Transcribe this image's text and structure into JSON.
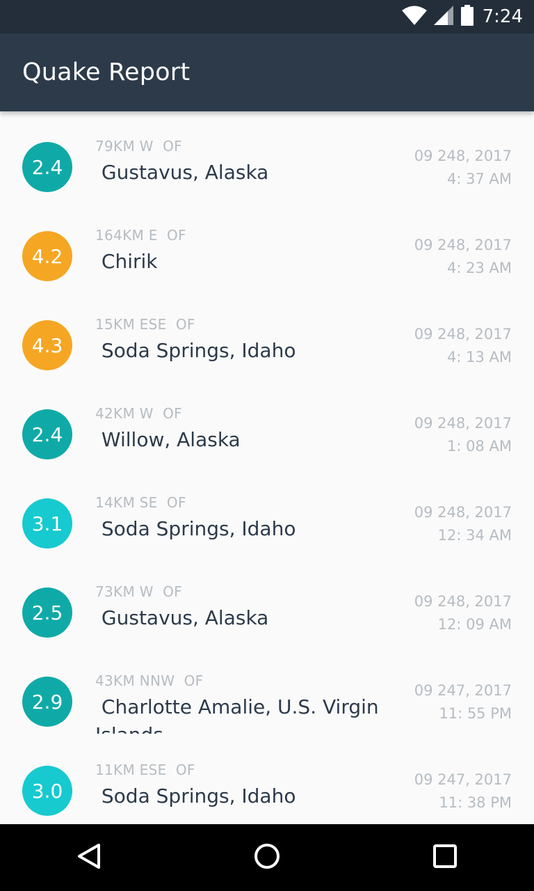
{
  "status_bar": {
    "time": "7:24",
    "icons": [
      "wifi-icon",
      "cell-signal-icon",
      "battery-icon"
    ]
  },
  "app_bar": {
    "title": "Quake Report",
    "color": "#2c3a4a"
  },
  "earthquakes": [
    {
      "magnitude": "2.4",
      "offset": "79KM W  OF",
      "place": " Gustavus, Alaska",
      "date": "09 248, 2017",
      "time": "4: 37 AM",
      "color": "#0faaa7"
    },
    {
      "magnitude": "4.2",
      "offset": "164KM E  OF",
      "place": " Chirik",
      "date": "09 248, 2017",
      "time": "4: 23 AM",
      "color": "#f5a623"
    },
    {
      "magnitude": "4.3",
      "offset": "15KM ESE  OF",
      "place": " Soda Springs, Idaho",
      "date": "09 248, 2017",
      "time": "4: 13 AM",
      "color": "#f5a623"
    },
    {
      "magnitude": "2.4",
      "offset": "42KM W  OF",
      "place": " Willow, Alaska",
      "date": "09 248, 2017",
      "time": "1: 08 AM",
      "color": "#0faaa7"
    },
    {
      "magnitude": "3.1",
      "offset": "14KM SE  OF",
      "place": " Soda Springs, Idaho",
      "date": "09 248, 2017",
      "time": "12: 34 AM",
      "color": "#16cad0"
    },
    {
      "magnitude": "2.5",
      "offset": "73KM W  OF",
      "place": " Gustavus, Alaska",
      "date": "09 248, 2017",
      "time": "12: 09 AM",
      "color": "#0faaa7"
    },
    {
      "magnitude": "2.9",
      "offset": "43KM NNW  OF",
      "place": " Charlotte Amalie, U.S. Virgin Islands",
      "date": "09 247, 2017",
      "time": "11: 55 PM",
      "color": "#0faaa7"
    },
    {
      "magnitude": "3.0",
      "offset": "11KM ESE  OF",
      "place": " Soda Springs, Idaho",
      "date": "09 247, 2017",
      "time": "11: 38 PM",
      "color": "#16cad0"
    }
  ],
  "nav_bar": {
    "buttons": [
      "back-icon",
      "home-icon",
      "recents-icon"
    ]
  }
}
